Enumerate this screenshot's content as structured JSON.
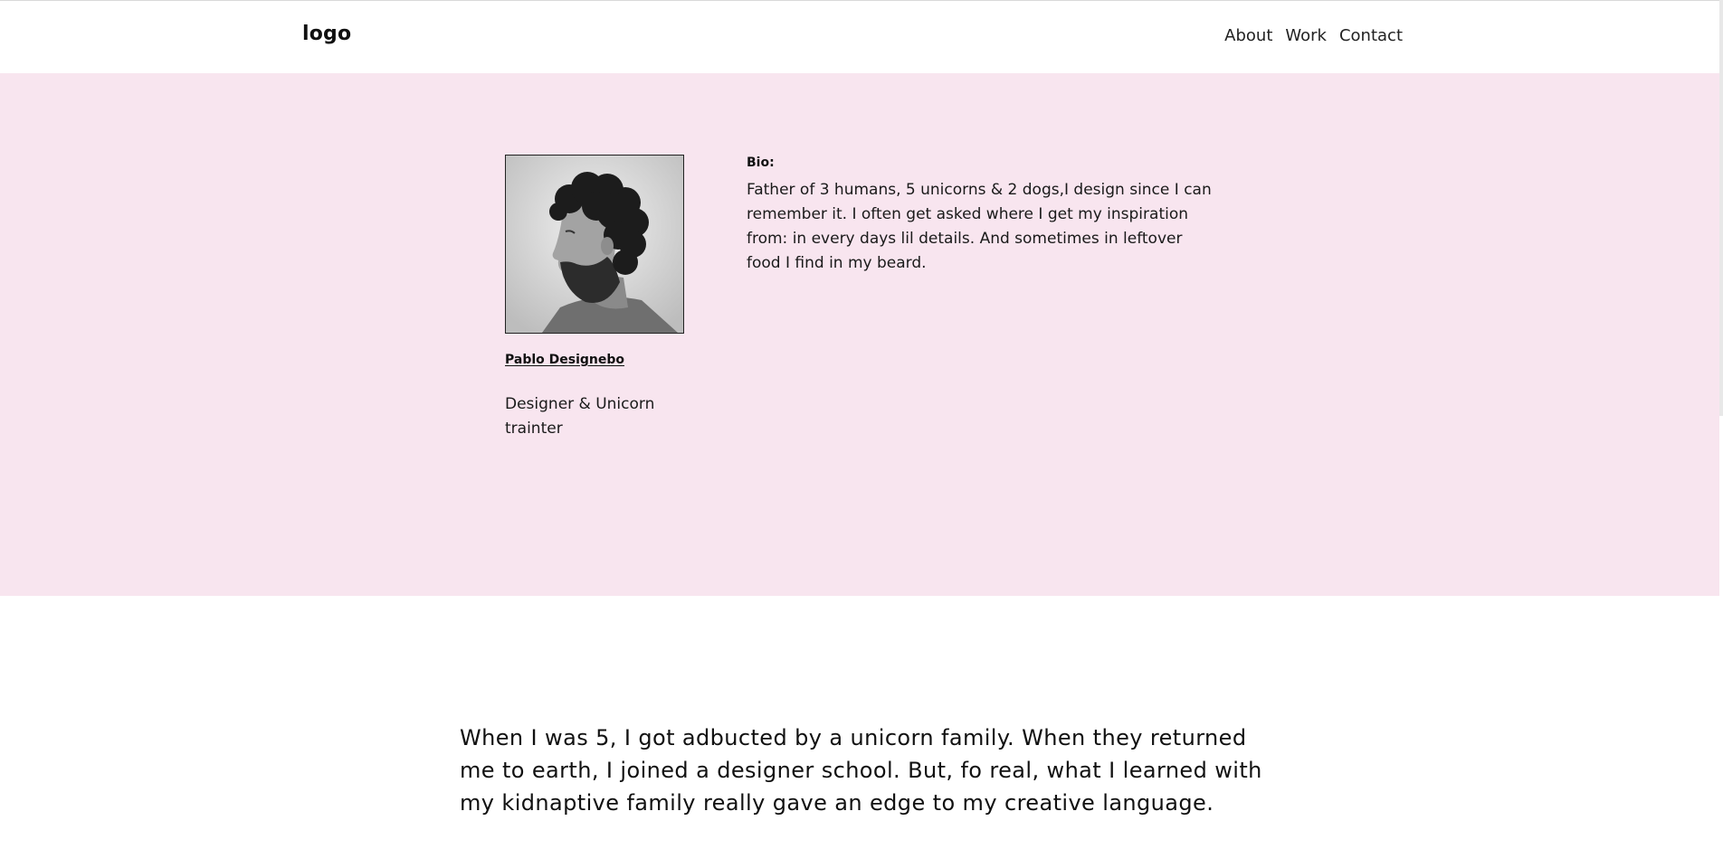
{
  "header": {
    "logo": "logo",
    "nav": [
      "About",
      "Work",
      "Contact"
    ]
  },
  "profile": {
    "name": "Pablo Designebo",
    "role": "Designer & Unicorn trainter",
    "bio_label": "Bio:",
    "bio_text": "Father of 3 humans, 5 unicorns & 2 dogs,I design since I can remember it. I often get asked where I get my inspiration from: in every days lil details. And sometimes in leftover food I find in my beard."
  },
  "story": "When I was 5, I got adbucted by a unicorn family. When they returned me to earth, I joined a designer school. But, fo real, what I learned with my kidnaptive family really gave an edge to my creative language.",
  "colors": {
    "hero_background": "#f8e5ef",
    "text": "#111111"
  }
}
